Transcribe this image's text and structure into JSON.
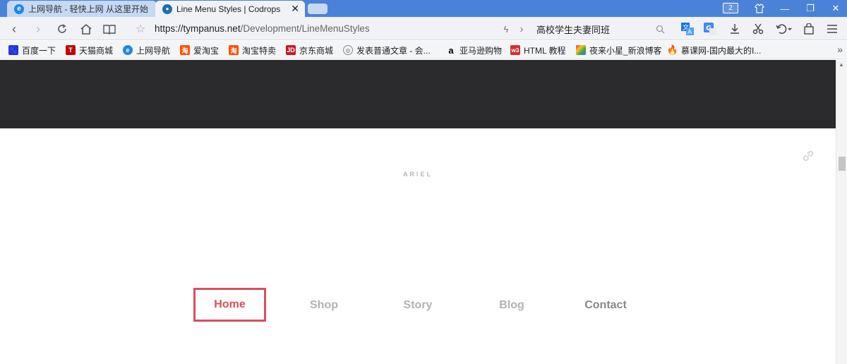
{
  "tabs": [
    {
      "title": "上网导航 - 轻快上网 从这里开始",
      "active": false
    },
    {
      "title": "Line Menu Styles | Codrops",
      "active": true
    }
  ],
  "window": {
    "badge": "2"
  },
  "address": {
    "scheme_host": "https://tympanus.net",
    "path": "/Development/LineMenuStyles",
    "search_text": "高校学生夫妻同班"
  },
  "bookmarks": [
    {
      "label": "百度一下",
      "icon": "paw-icon",
      "color": "#2932e1"
    },
    {
      "label": "天猫商城",
      "icon": "tmall-icon",
      "color": "#c40000"
    },
    {
      "label": "上网导航",
      "icon": "ie-icon",
      "color": "#1e88e5"
    },
    {
      "label": "爱淘宝",
      "icon": "taobao-icon",
      "color": "#ff5000"
    },
    {
      "label": "淘宝特卖",
      "icon": "taobao-sale-icon",
      "color": "#ff5000"
    },
    {
      "label": "京东商城",
      "icon": "jd-icon",
      "color": "#c91623"
    },
    {
      "label": "发表普通文章 - 会...",
      "icon": "globe-icon",
      "color": "#666666"
    },
    {
      "label": "亚马逊购物",
      "icon": "amazon-icon",
      "color": "#000000"
    },
    {
      "label": "HTML 教程",
      "icon": "w3-icon",
      "color": "#d32f2f"
    },
    {
      "label": "夜来小星_新浪博客",
      "icon": "sina-blog-icon",
      "color": "#7b2cbf"
    },
    {
      "label": "慕课网-国内最大的I...",
      "icon": "flame-icon",
      "color": "#e53935"
    }
  ],
  "page": {
    "section_label": "ARIEL",
    "menu": [
      "Home",
      "Shop",
      "Story",
      "Blog",
      "Contact"
    ],
    "active_index": 0,
    "accent_color": "#d94f5c",
    "band_color": "#2b2a2d"
  }
}
